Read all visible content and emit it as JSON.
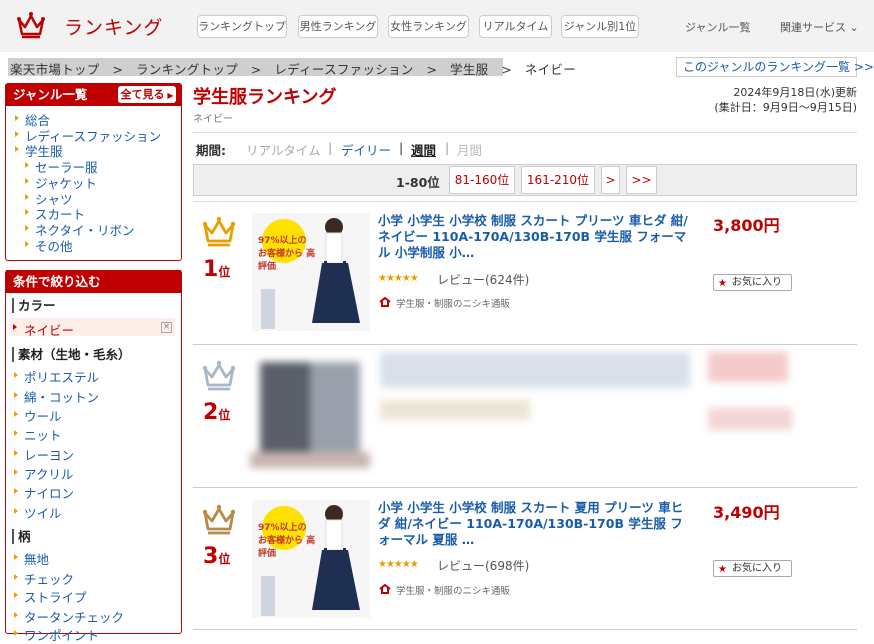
{
  "header": {
    "title": "ランキング",
    "nav_buttons": [
      "ランキングトップ",
      "男性ランキング",
      "女性ランキング",
      "リアルタイム",
      "ジャンル別1位"
    ],
    "genre_list": "ジャンル一覧",
    "related": "関連サービス"
  },
  "breadcrumb": "楽天市場トップ　>　ランキングトップ　>　レディースファッション　>　学生服　>　ネイビー",
  "genre_ranking_link": "このジャンルのランキング一覧 >>",
  "sidebar": {
    "genre_head": "ジャンル一覧",
    "all_button": "全て見る",
    "genres": [
      "総合",
      "レディースファッション",
      "学生服"
    ],
    "subgenres": [
      "セーラー服",
      "ジャケット",
      "シャツ",
      "スカート",
      "ネクタイ・リボン",
      "その他"
    ],
    "filter_head": "条件で絞り込む",
    "color_title": "カラー",
    "color_selected": "ネイビー",
    "material_title": "素材（生地・毛糸）",
    "materials": [
      "ポリエステル",
      "綿・コットン",
      "ウール",
      "ニット",
      "レーヨン",
      "アクリル",
      "ナイロン",
      "ツイル"
    ],
    "pattern_title": "柄",
    "patterns": [
      "無地",
      "チェック",
      "ストライプ",
      "タータンチェック",
      "ワンポイント"
    ]
  },
  "main": {
    "title": "学生服ランキング",
    "subtitle": "ネイビー",
    "updated": "2024年9月18日(水)更新",
    "period_range": "(集計日：9月9日～9月15日)",
    "period_label": "期間:",
    "periods": [
      "リアルタイム",
      "デイリー",
      "週間",
      "月間"
    ],
    "pager_current": "1-80位",
    "pager_buttons": [
      "81-160位",
      "161-210位",
      ">",
      ">>"
    ]
  },
  "items": [
    {
      "rank": "1",
      "rank_suffix": "位",
      "name": "小学 小学生 小学校 制服 スカート プリーツ 車ヒダ 紺/ネイビー 110A-170A/130B-170B 学生服 フォーマル 小学制服 小…",
      "price": "3,800円",
      "review": "レビュー(624件)",
      "shop": "学生服・制服のニシキ通販",
      "fav": "お気に入り",
      "thumb_text": "97%以上の お客様から 高評価"
    },
    {
      "rank": "2",
      "rank_suffix": "位"
    },
    {
      "rank": "3",
      "rank_suffix": "位",
      "name": "小学 小学生 小学校 制服 スカート 夏用 プリーツ 車ヒダ 紺/ネイビー 110A-170A/130B-170B 学生服 フォーマル 夏服 …",
      "price": "3,490円",
      "review": "レビュー(698件)",
      "shop": "学生服・制服のニシキ通販",
      "fav": "お気に入り",
      "thumb_text": "97%以上の お客様から 高評価"
    }
  ],
  "colors": {
    "accent": "#bf0000",
    "link": "#1a5caa",
    "gold": "#e8a000",
    "silver": "#a9b8c6",
    "bronze": "#b88a4a"
  }
}
